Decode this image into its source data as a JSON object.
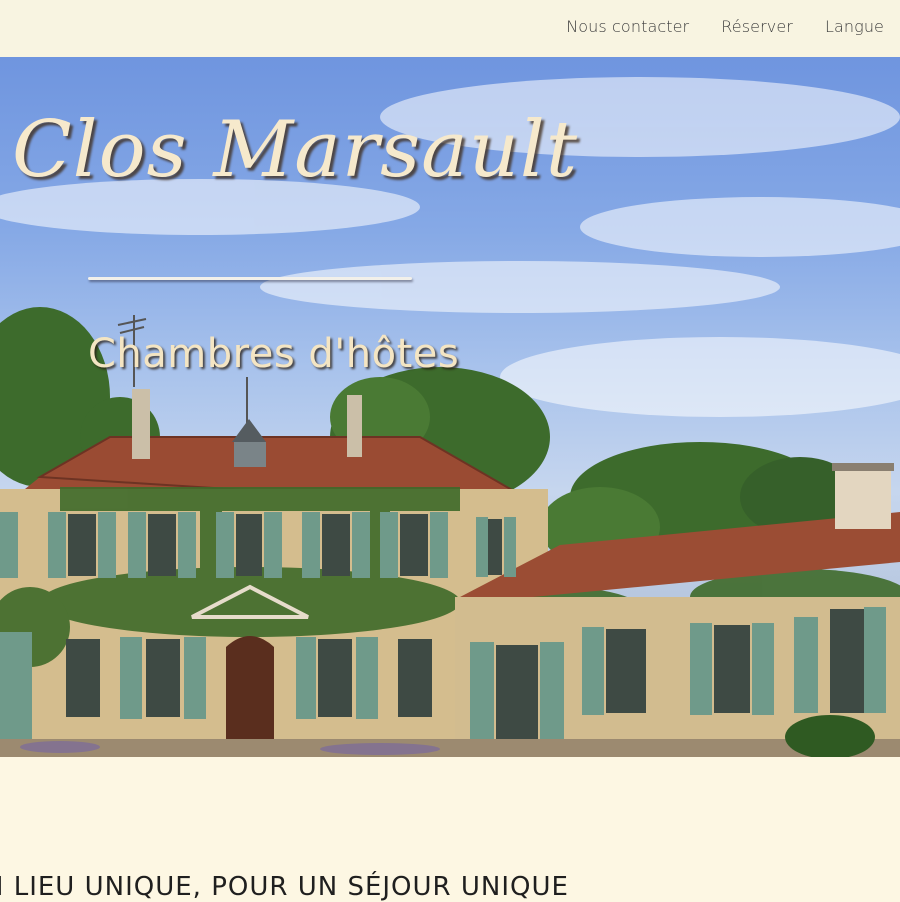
{
  "nav": {
    "items": [
      {
        "label": "Nous contacter"
      },
      {
        "label": "Réserver"
      },
      {
        "label": "Langue"
      }
    ]
  },
  "hero": {
    "title": "Clos Marsault",
    "subtitle": "Chambres d'hôtes"
  },
  "section": {
    "heading": "N LIEU UNIQUE, POUR UN SÉJOUR UNIQUE"
  },
  "colors": {
    "page_background": "#fdf7e3",
    "topbar_background": "#f8f4e1",
    "title_color": "#f6e9cc",
    "shutter_green": "#6f9a8a"
  }
}
